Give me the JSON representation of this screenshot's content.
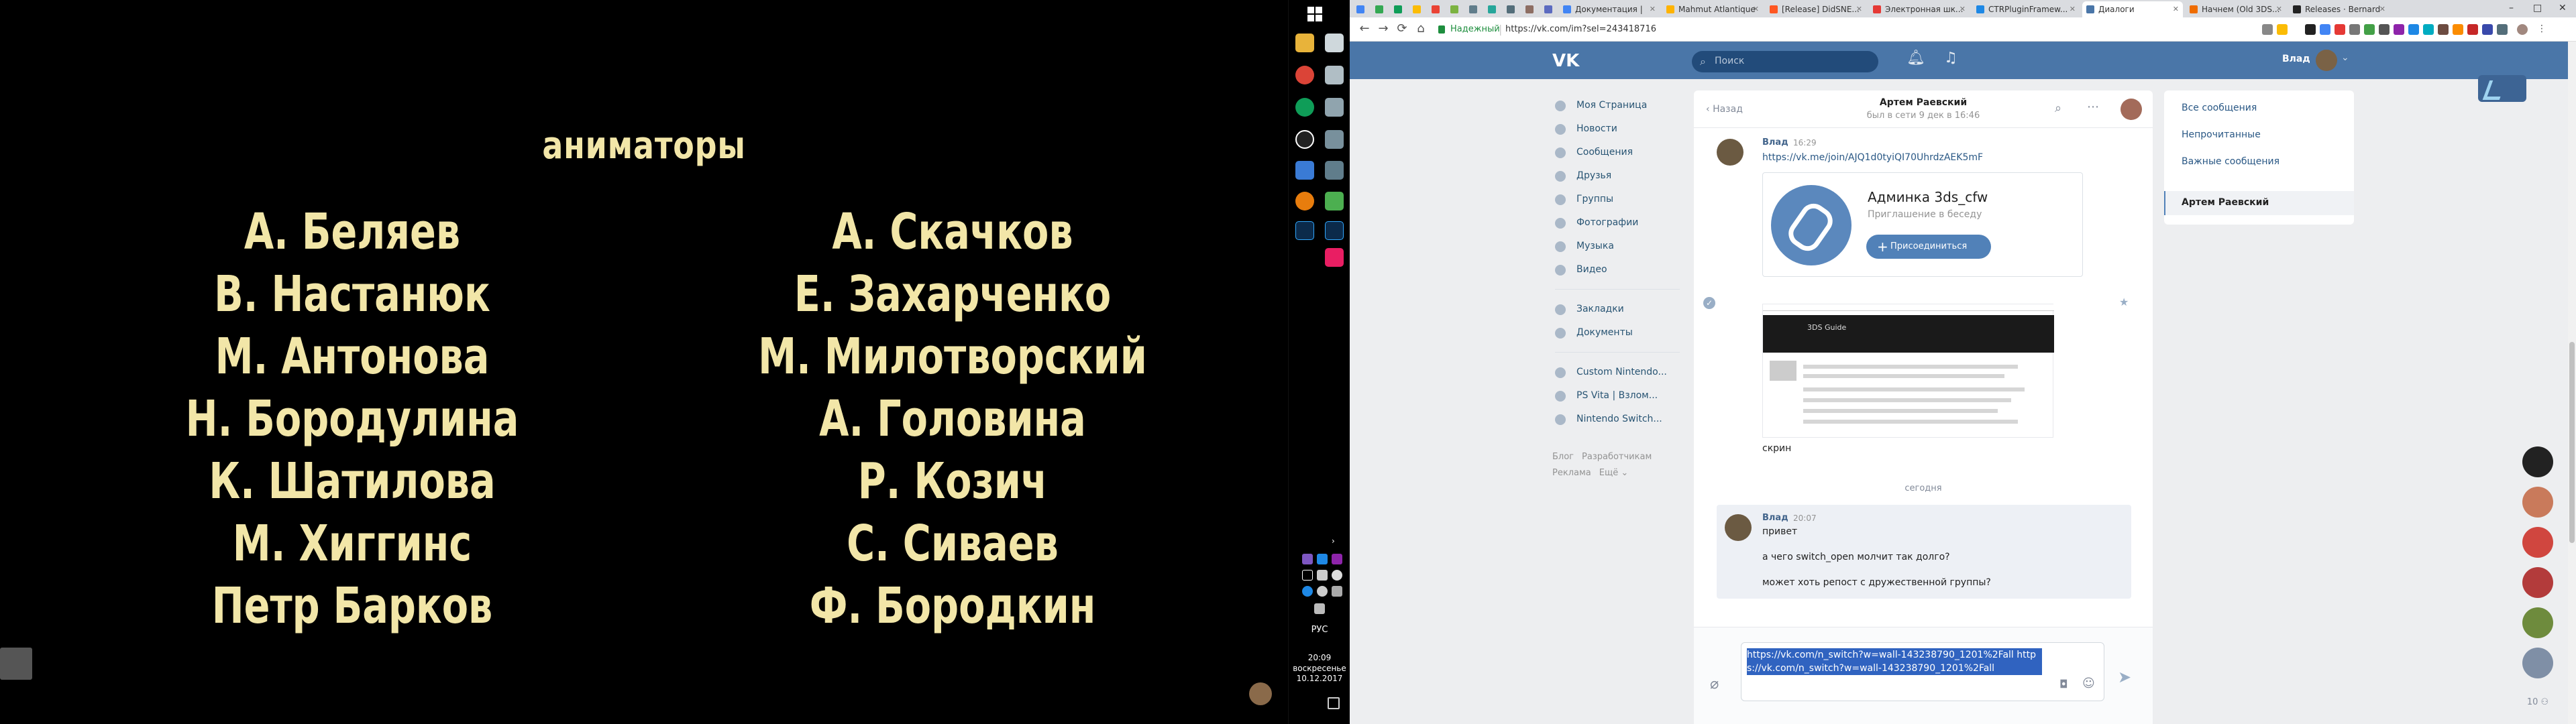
{
  "video": {
    "heading": "аниматоры",
    "left_names": [
      "А. Беляев",
      "В. Настанюк",
      "М. Антонова",
      "Н. Бородулина",
      "К. Шатилова",
      "М. Хиггинс",
      "Петр Барков"
    ],
    "right_names": [
      "А. Скачков",
      "Е. Захарченко",
      "М. Милотворский",
      "А. Головина",
      "Р. Козич",
      "С. Сиваев",
      "Ф. Бородкин"
    ]
  },
  "taskbar": {
    "lang": "РУС",
    "time": "20:09",
    "weekday": "воскресенье",
    "date": "10.12.2017"
  },
  "browser": {
    "tabs": [
      {
        "label": ""
      },
      {
        "label": ""
      },
      {
        "label": "Документация | "
      },
      {
        "label": "Mahmut Atlantique"
      },
      {
        "label": "[Release] DidSNE..."
      },
      {
        "label": "Электронная шк..."
      },
      {
        "label": "CTRPluginFramew..."
      },
      {
        "label": "Диалоги"
      },
      {
        "label": "Начнем (Old 3DS..."
      },
      {
        "label": "Releases · Bernard"
      }
    ],
    "window_controls": {
      "minimize": "–",
      "maximize": "□",
      "close": "✕"
    },
    "nav": {
      "back": "←",
      "forward": "→",
      "reload": "⟳",
      "home": "⌂"
    },
    "secure_label": "Надежный",
    "url": "https://vk.com/im?sel=243418716"
  },
  "vk": {
    "logo": "VK",
    "search_placeholder": "Поиск",
    "user_name": "Влад",
    "nav_items": [
      "Моя Страница",
      "Новости",
      "Сообщения",
      "Друзья",
      "Группы",
      "Фотографии",
      "Музыка",
      "Видео"
    ],
    "nav_items_2": [
      "Закладки",
      "Документы"
    ],
    "nav_items_3": [
      "Custom Nintendo...",
      "PS Vita | Взлом...",
      "Nintendo Switch..."
    ],
    "footer": [
      "Блог",
      "Разработчикам",
      "Реклама",
      "Ещё ⌄"
    ],
    "chat": {
      "back": "Назад",
      "name": "Артем Раевский",
      "status": "был в сети 9 дек в 16:46",
      "msg1_author": "Влад",
      "msg1_time": "16:29",
      "msg1_link": "https://vk.me/join/AJQ1d0tyiQI70UhrdzAEK5mF",
      "invite_title": "Админка 3ds_cfw",
      "invite_sub": "Приглашение в беседу",
      "invite_btn": "Присоединиться",
      "screenshot_title": "3DS Guide",
      "screen_caption": "скрин",
      "date_divider": "сегодня",
      "msg2_author": "Влад",
      "msg2_time": "20:07",
      "msg2_lines": [
        "привет",
        "а чего switch_open молчит так долго?",
        "может хоть репост с дружественной группы?"
      ],
      "compose_text": "https://vk.com/n_switch?w=wall-143238790_1201%2Fall https://vk.com/n_switch?w=wall-143238790_1201%2Fall"
    },
    "filters": [
      "Все сообщения",
      "Непрочитанные",
      "Важные сообщения"
    ],
    "active_filter": "Артем Раевский",
    "bubble_count": "10 ⚇"
  }
}
